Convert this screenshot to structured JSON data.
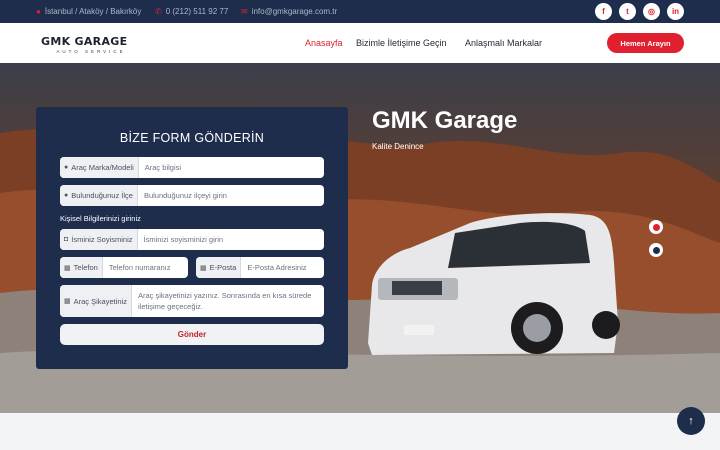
{
  "topbar": {
    "address": "İstanbul / Ataköy / Bakırköy",
    "phone": "0 (212) 511 92 77",
    "email": "info@gmkgarage.com.tr",
    "socials": [
      {
        "icon": "facebook-icon",
        "glyph": "f"
      },
      {
        "icon": "twitter-icon",
        "glyph": "t"
      },
      {
        "icon": "instagram-icon",
        "glyph": "◎"
      },
      {
        "icon": "linkedin-icon",
        "glyph": "in"
      }
    ]
  },
  "header": {
    "logo_main": "GMK GARAGE",
    "logo_sub": "AUTO SERVICE",
    "nav": [
      "Anasayfa",
      "Bizimle İletişime Geçin",
      "Anlaşmalı Markalar"
    ],
    "active_nav": "Anasayfa",
    "cta": "Hemen Arayın"
  },
  "hero": {
    "title": "GMK Garage",
    "subtitle": "Kalite Denince",
    "slides": 2,
    "active_slide": 1
  },
  "form": {
    "title": "BİZE FORM GÖNDERİN",
    "car_label": "Araç Marka/Modeli",
    "car_placeholder": "Araç bilgisi",
    "district_label": "Bulunduğunuz İlçe",
    "district_placeholder": "Bulunduğunuz ilçeyi girin",
    "personal_section": "Kişisel Bilgilerinizi giriniz",
    "name_label": "İsminiz Soyisminiz",
    "name_placeholder": "İsminizi soyisminizi girin",
    "phone_label": "Telefon",
    "phone_placeholder": "Telefon numaranız",
    "email_label": "E-Posta",
    "email_placeholder": "E-Posta Adresiniz",
    "complaint_label": "Araç Şikayetiniz",
    "complaint_placeholder": "Araç şikayetinizi yazınız. Sonrasında en kısa sürede iletişime geçeceğiz.",
    "submit": "Gönder"
  },
  "colors": {
    "navy": "#1f2d4d",
    "accent": "#e0202e"
  }
}
